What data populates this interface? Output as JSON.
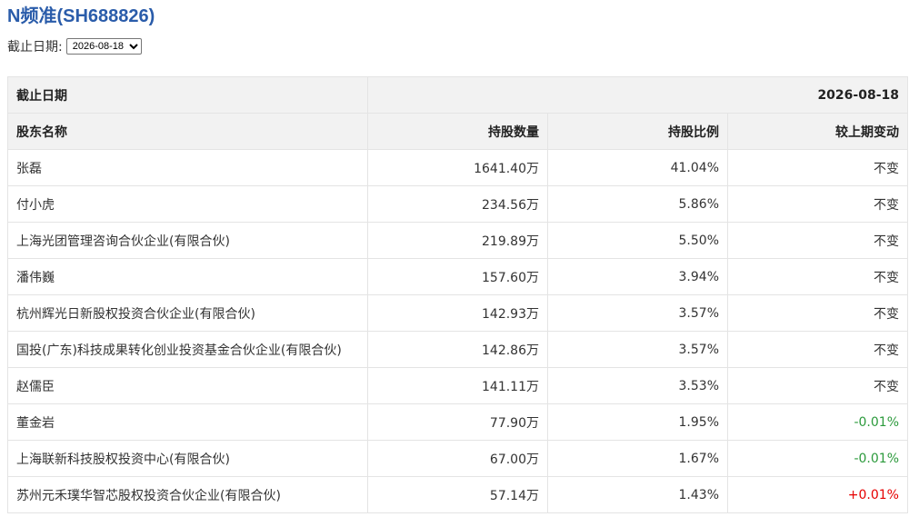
{
  "page": {
    "title": "N频准(SH688826)",
    "date_label": "截止日期:",
    "date_selected": "2026-08-18"
  },
  "table": {
    "date_header": "截止日期",
    "date_value": "2026-08-18",
    "columns": [
      "股东名称",
      "持股数量",
      "持股比例",
      "较上期变动"
    ],
    "rows": [
      {
        "name": "张磊",
        "shares": "1641.40万",
        "ratio": "41.04%",
        "change": "不变",
        "trend": "flat"
      },
      {
        "name": "付小虎",
        "shares": "234.56万",
        "ratio": "5.86%",
        "change": "不变",
        "trend": "flat"
      },
      {
        "name": "上海光团管理咨询合伙企业(有限合伙)",
        "shares": "219.89万",
        "ratio": "5.50%",
        "change": "不变",
        "trend": "flat"
      },
      {
        "name": "潘伟巍",
        "shares": "157.60万",
        "ratio": "3.94%",
        "change": "不变",
        "trend": "flat"
      },
      {
        "name": "杭州辉光日新股权投资合伙企业(有限合伙)",
        "shares": "142.93万",
        "ratio": "3.57%",
        "change": "不变",
        "trend": "flat"
      },
      {
        "name": "国投(广东)科技成果转化创业投资基金合伙企业(有限合伙)",
        "shares": "142.86万",
        "ratio": "3.57%",
        "change": "不变",
        "trend": "flat"
      },
      {
        "name": "赵儒臣",
        "shares": "141.11万",
        "ratio": "3.53%",
        "change": "不变",
        "trend": "flat"
      },
      {
        "name": "董金岩",
        "shares": "77.90万",
        "ratio": "1.95%",
        "change": "-0.01%",
        "trend": "down"
      },
      {
        "name": "上海联新科技股权投资中心(有限合伙)",
        "shares": "67.00万",
        "ratio": "1.67%",
        "change": "-0.01%",
        "trend": "down"
      },
      {
        "name": "苏州元禾璞华智芯股权投资合伙企业(有限合伙)",
        "shares": "57.14万",
        "ratio": "1.43%",
        "change": "+0.01%",
        "trend": "up"
      }
    ]
  },
  "colors": {
    "title": "#2a5caa",
    "header_bg": "#f2f2f2",
    "border": "#e4e4e4",
    "increase": "#e60000",
    "decrease": "#2c9a3c"
  }
}
